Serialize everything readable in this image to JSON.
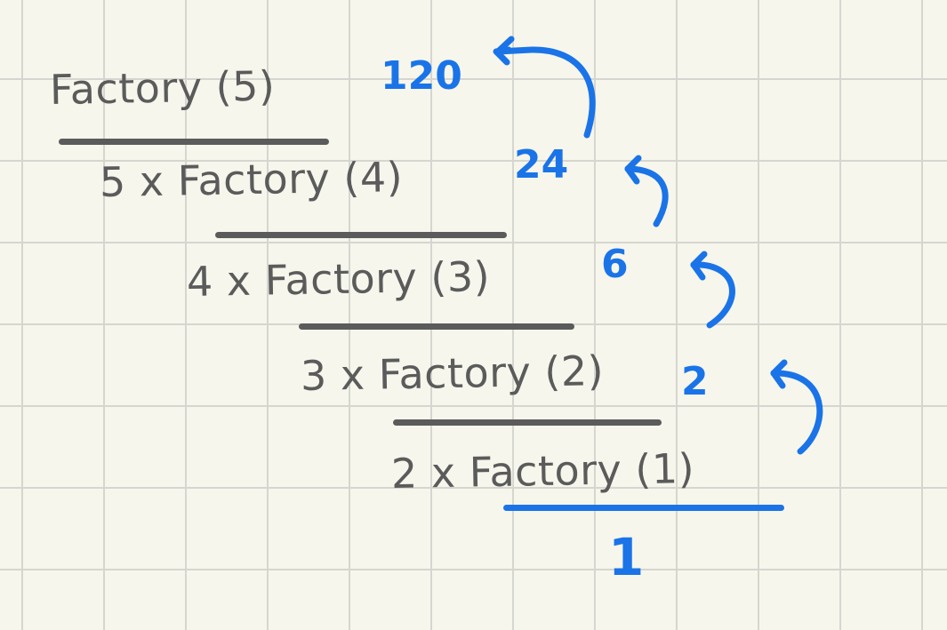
{
  "steps": [
    "Factory (5)",
    "5 x Factory (4)",
    "4 x Factory (3)",
    "3 x Factory (2)",
    "2 x Factory (1)"
  ],
  "values": [
    "120",
    "24",
    "6",
    "2",
    "1"
  ],
  "colors": {
    "ink": "#5b5b5b",
    "accent": "#1a74e8",
    "paper": "#f7f6ec",
    "grid": "#d6d6d0"
  }
}
